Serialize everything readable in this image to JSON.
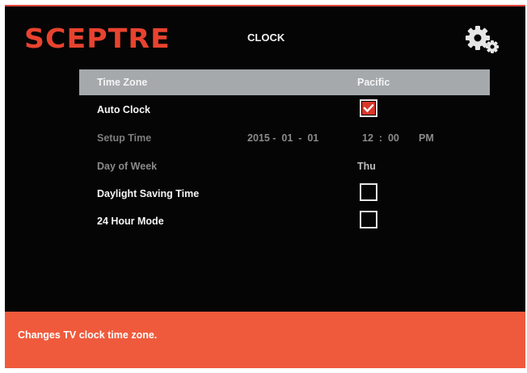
{
  "brand": {
    "logo_text": "SCEPTRE",
    "accent_color": "#e8432f"
  },
  "header": {
    "title": "CLOCK",
    "settings_icon": "gear-icon"
  },
  "menu": {
    "rows": [
      {
        "label": "Time Zone",
        "value": "Pacific",
        "state": "highlighted"
      },
      {
        "label": "Auto Clock",
        "checked": true
      },
      {
        "label": "Setup Time",
        "date": "2015 -  01  -  01",
        "time": "12  :  00",
        "ampm": "PM",
        "state": "disabled"
      },
      {
        "label": "Day of Week",
        "value": "Thu",
        "state": "disabled"
      },
      {
        "label": "Daylight Saving Time",
        "checked": false
      },
      {
        "label": "24 Hour Mode",
        "checked": false
      }
    ]
  },
  "footer": {
    "help_text": "Changes TV clock time zone.",
    "color": "#ef5a3c"
  }
}
